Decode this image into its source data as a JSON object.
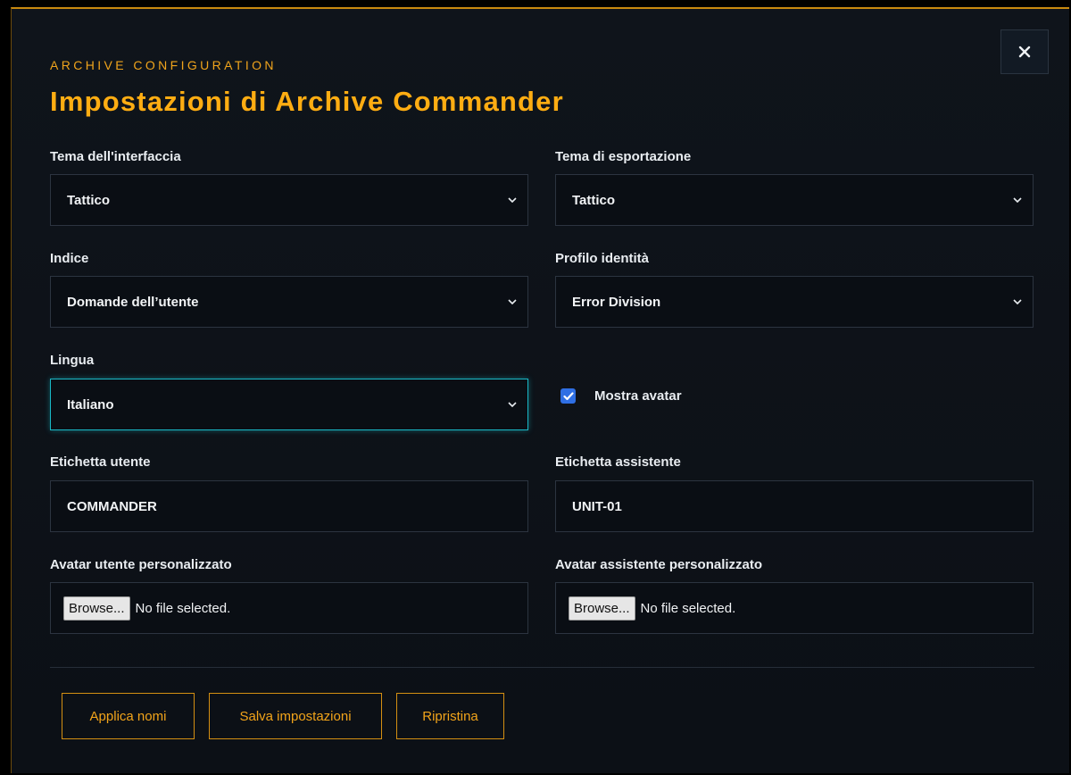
{
  "header": {
    "eyebrow": "ARCHIVE CONFIGURATION",
    "title": "Impostazioni di Archive Commander"
  },
  "close": {
    "icon": "close-icon"
  },
  "fields": {
    "interface_theme": {
      "label": "Tema dell'interfaccia",
      "value": "Tattico"
    },
    "export_theme": {
      "label": "Tema di esportazione",
      "value": "Tattico"
    },
    "index": {
      "label": "Indice",
      "value": "Domande dell’utente"
    },
    "identity_profile": {
      "label": "Profilo identità",
      "value": "Error Division"
    },
    "language": {
      "label": "Lingua",
      "value": "Italiano"
    },
    "show_avatar": {
      "label": "Mostra avatar",
      "checked": true
    },
    "user_label": {
      "label": "Etichetta utente",
      "value": "COMMANDER"
    },
    "assistant_label": {
      "label": "Etichetta assistente",
      "value": "UNIT-01"
    },
    "user_avatar": {
      "label": "Avatar utente personalizzato",
      "button": "Browse...",
      "status": "No file selected."
    },
    "assistant_avatar": {
      "label": "Avatar assistente personalizzato",
      "button": "Browse...",
      "status": "No file selected."
    }
  },
  "actions": {
    "apply_names": "Applica nomi",
    "save_settings": "Salva impostazioni",
    "reset": "Ripristina"
  },
  "colors": {
    "accent": "#ffad12",
    "focus": "#19b8c6",
    "checkbox": "#2f6fe4",
    "background": "#0f141b"
  }
}
